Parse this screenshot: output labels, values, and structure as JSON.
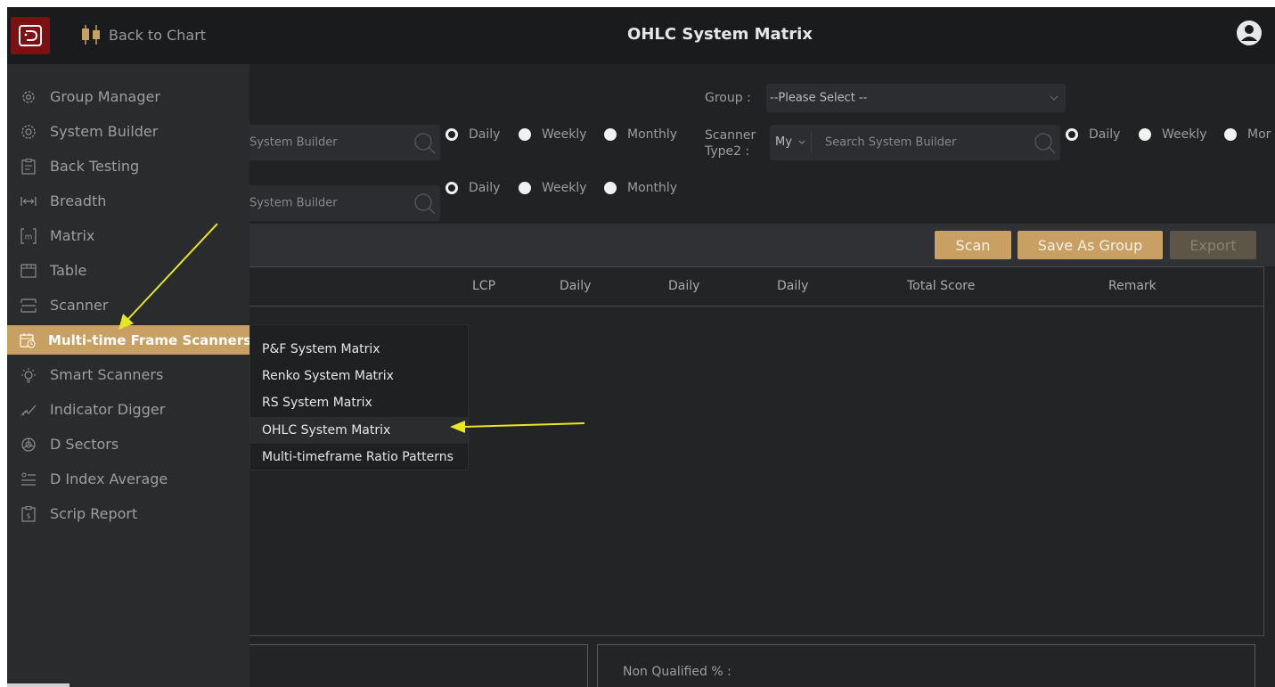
{
  "topbar": {
    "back_label": "Back to Chart",
    "title": "OHLC System Matrix"
  },
  "filters": {
    "group_label": "Group :",
    "group_value": "--Please Select --",
    "row1_search_placeholder": "System Builder",
    "scanner_type2_label_line1": "Scanner",
    "scanner_type2_label_line2": "Type2 :",
    "scanner_type2_select": "My",
    "row1_search2_placeholder": "Search System Builder",
    "row2_search_placeholder": "System Builder",
    "radio_daily": "Daily",
    "radio_weekly": "Weekly",
    "radio_monthly": "Monthly",
    "radio_monthly_cut": "Mor"
  },
  "buttons": {
    "scan": "Scan",
    "save_as_group": "Save As Group",
    "export": "Export"
  },
  "table": {
    "headers": [
      "LCP",
      "Daily",
      "Daily",
      "Daily",
      "Total Score",
      "Remark"
    ]
  },
  "summary": {
    "non_qualified_label": "Non Qualified % :"
  },
  "sidebar": {
    "items": [
      {
        "label": "Group Manager",
        "icon": "gear-group-icon"
      },
      {
        "label": "System Builder",
        "icon": "gear-icon"
      },
      {
        "label": "Back Testing",
        "icon": "clipboard-icon"
      },
      {
        "label": "Breadth",
        "icon": "breadth-icon"
      },
      {
        "label": "Matrix",
        "icon": "matrix-icon"
      },
      {
        "label": "Table",
        "icon": "table-icon"
      },
      {
        "label": "Scanner",
        "icon": "scanner-icon"
      },
      {
        "label": "Multi-time Frame Scanners",
        "icon": "calendar-clock-icon"
      },
      {
        "label": "Smart Scanners",
        "icon": "bulb-icon"
      },
      {
        "label": "Indicator Digger",
        "icon": "trend-icon"
      },
      {
        "label": "D Sectors",
        "icon": "pie-chart-icon"
      },
      {
        "label": "D Index Average",
        "icon": "index-average-icon"
      },
      {
        "label": "Scrip Report",
        "icon": "report-icon"
      }
    ],
    "active_index": 7
  },
  "dropdown": {
    "items": [
      "P&F System Matrix",
      "Renko System Matrix",
      "RS System Matrix",
      "OHLC System Matrix",
      "Multi-timeframe Ratio Patterns"
    ],
    "highlighted_index": 3
  },
  "colors": {
    "accent_gold": "#c9a063",
    "logo_red": "#7a1214",
    "annotation_arrow": "#e8e822"
  }
}
